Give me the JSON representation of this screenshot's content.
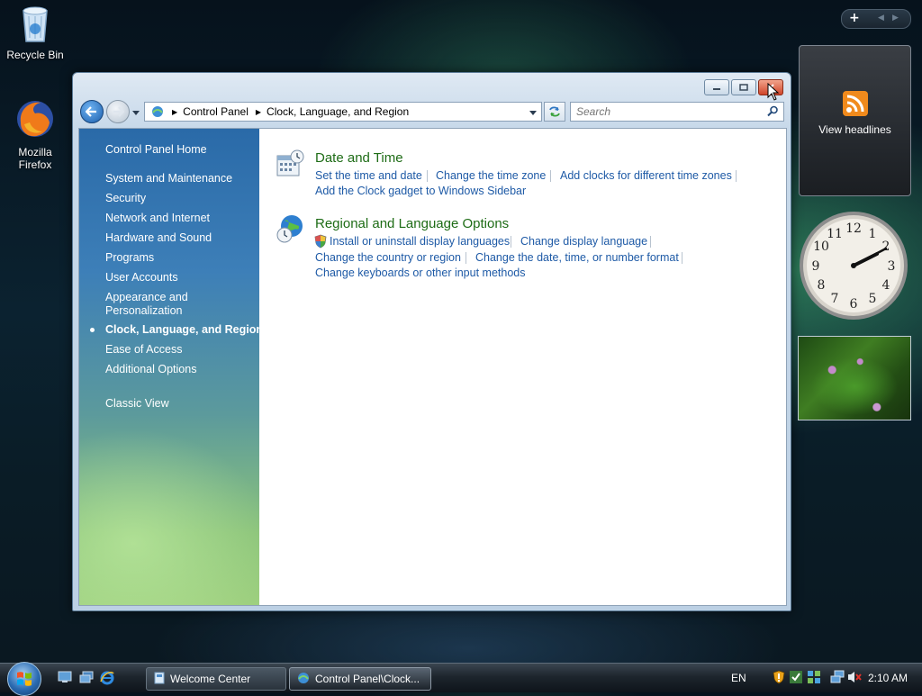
{
  "desktop": {
    "recycle_bin": "Recycle Bin",
    "firefox_line1": "Mozilla",
    "firefox_line2": "Firefox"
  },
  "window": {
    "address": {
      "segments": [
        "Control Panel",
        "Clock, Language, and Region"
      ]
    },
    "search": {
      "placeholder": "Search"
    },
    "sidebar": {
      "home": "Control Panel Home",
      "items": [
        "System and Maintenance",
        "Security",
        "Network and Internet",
        "Hardware and Sound",
        "Programs",
        "User Accounts",
        "Appearance and",
        "Personalization",
        "Clock, Language, and Region",
        "Ease of Access",
        "Additional Options"
      ],
      "classic": "Classic View"
    },
    "categories": [
      {
        "title": "Date and Time",
        "links": [
          "Set the time and date",
          "Change the time zone",
          "Add clocks for different time zones",
          "Add the Clock gadget to Windows Sidebar"
        ]
      },
      {
        "title": "Regional and Language Options",
        "links": [
          "Install or uninstall display languages",
          "Change display language",
          "Change the country or region",
          "Change the date, time, or number format",
          "Change keyboards or other input methods"
        ]
      }
    ]
  },
  "gadgets": {
    "feeds_label": "View headlines"
  },
  "taskbar": {
    "tasks": [
      "Welcome Center",
      "Control Panel\\Clock..."
    ],
    "language": "EN",
    "time": "2:10 AM"
  }
}
